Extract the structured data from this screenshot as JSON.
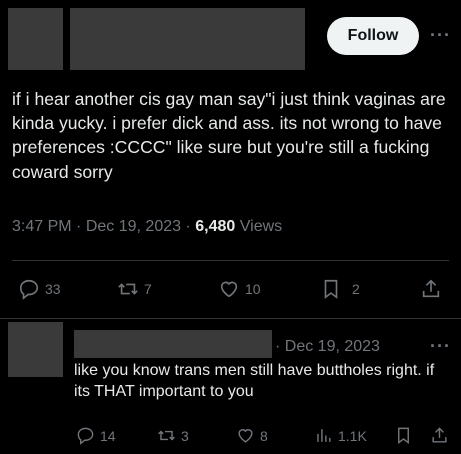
{
  "main_tweet": {
    "follow_label": "Follow",
    "more_label": "···",
    "text": "if i hear another cis gay man say\"i just think vaginas are kinda yucky. i prefer dick and ass. its not wrong to have preferences :CCCC\" like sure but you're still a fucking coward sorry",
    "time": "3:47 PM",
    "date": "Dec 19, 2023",
    "views_count": "6,480",
    "views_label": "Views",
    "replies": "33",
    "reposts": "7",
    "likes": "10",
    "bookmarks": "2"
  },
  "reply_tweet": {
    "date": "· Dec 19, 2023",
    "more_label": "···",
    "text": "like you know trans men still have buttholes right. if its THAT important to you",
    "replies": "14",
    "reposts": "3",
    "likes": "8",
    "views": "1.1K"
  },
  "colors": {
    "background": "#000000",
    "text": "#e7e9ea",
    "muted": "#71767b",
    "redaction": "#3a3a3a"
  }
}
